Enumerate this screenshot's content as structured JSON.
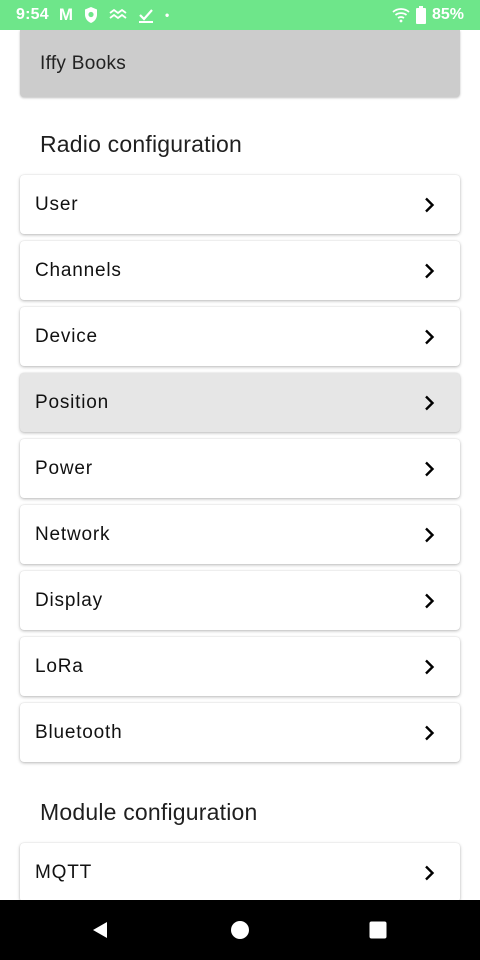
{
  "status_bar": {
    "time": "9:54",
    "gmail_letter": "M",
    "battery": "85%",
    "dot": "•",
    "icons": [
      "shield-icon",
      "wave-icon",
      "download-done-icon",
      "wifi-icon",
      "battery-icon"
    ],
    "color": "#6ee68a"
  },
  "node": {
    "name": "Iffy Books"
  },
  "radio_section": {
    "title": "Radio configuration",
    "items": [
      {
        "label": "User"
      },
      {
        "label": "Channels"
      },
      {
        "label": "Device"
      },
      {
        "label": "Position",
        "pressed": true
      },
      {
        "label": "Power"
      },
      {
        "label": "Network"
      },
      {
        "label": "Display"
      },
      {
        "label": "LoRa"
      },
      {
        "label": "Bluetooth"
      }
    ]
  },
  "module_section": {
    "title": "Module configuration",
    "items": [
      {
        "label": "MQTT"
      }
    ]
  },
  "nav_bar": {
    "icons": [
      "back-icon",
      "home-icon",
      "recents-icon"
    ]
  }
}
